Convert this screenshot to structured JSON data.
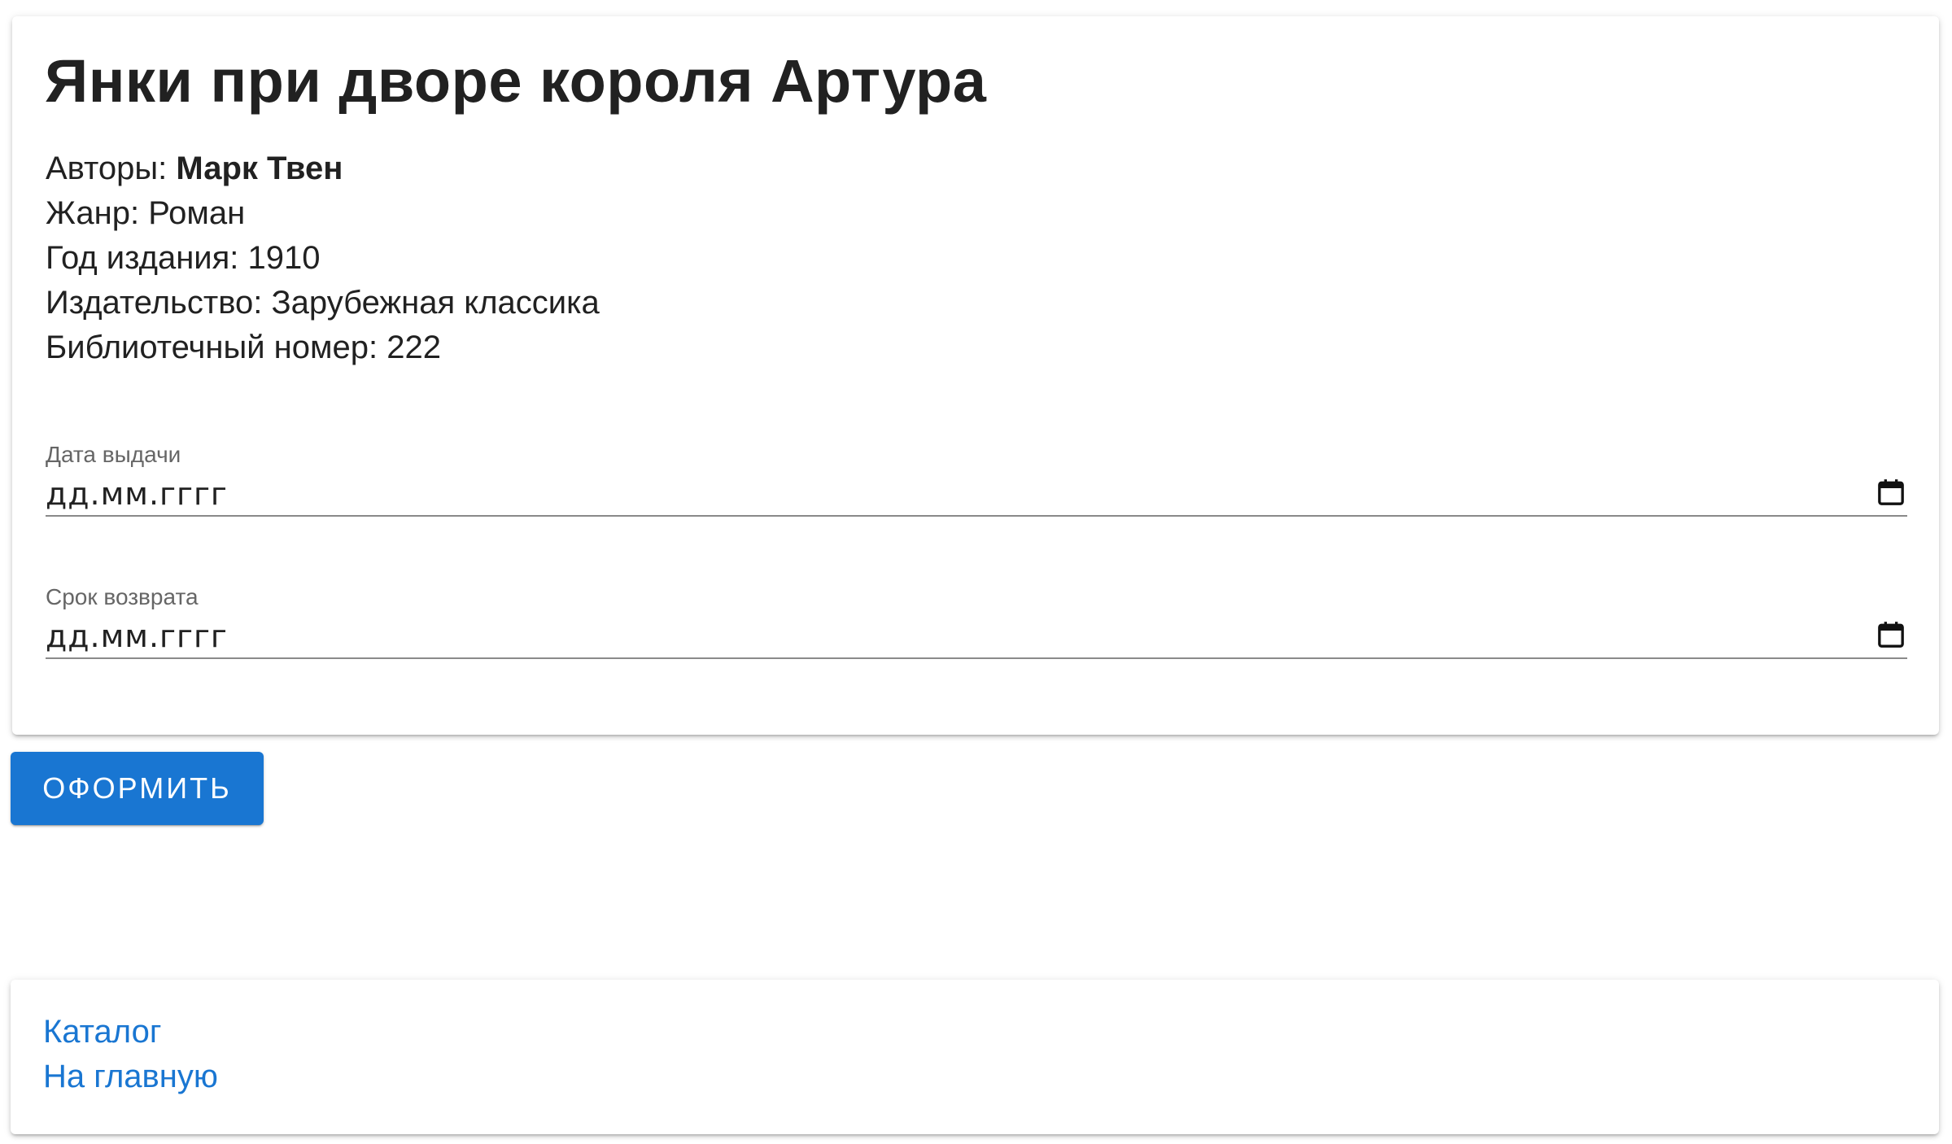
{
  "book": {
    "title": "Янки при дворе короля Артура",
    "authors_label": "Авторы: ",
    "authors_value": "Марк Твен",
    "genre_label": "Жанр: ",
    "genre_value": "Роман",
    "year_label": "Год издания: ",
    "year_value": "1910",
    "publisher_label": "Издательство: ",
    "publisher_value": "Зарубежная классика",
    "library_number_label": "Библиотечный номер: ",
    "library_number_value": "222"
  },
  "form": {
    "issue_date": {
      "label": "Дата выдачи",
      "value": "дд.мм.гггг",
      "icon": "calendar-icon"
    },
    "return_date": {
      "label": "Срок возврата",
      "value": "дд.мм.гггг",
      "icon": "calendar-icon"
    },
    "submit_label": "ОФОРМИТЬ"
  },
  "nav": {
    "catalog_label": "Каталог",
    "home_label": "На главную"
  },
  "colors": {
    "accent": "#1976d2",
    "text": "#212121",
    "label": "#666666"
  }
}
